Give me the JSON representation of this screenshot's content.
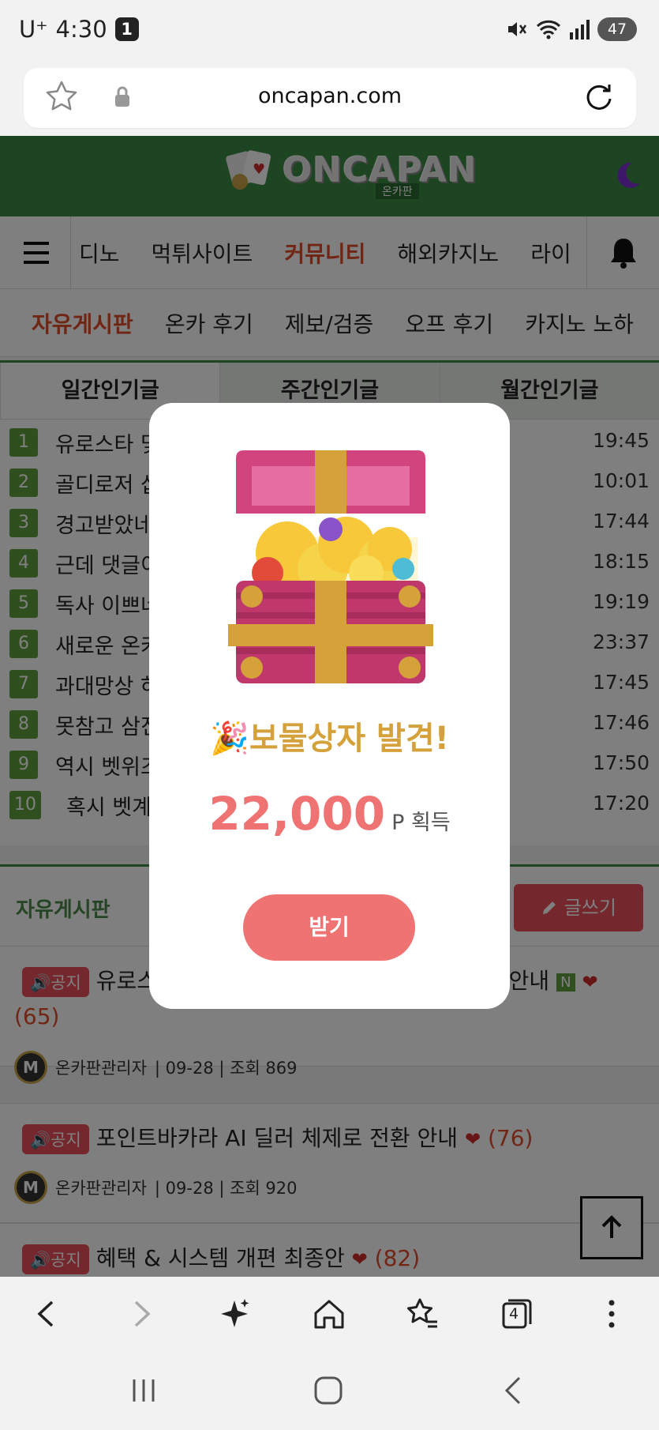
{
  "status_bar": {
    "carrier": "U⁺",
    "time": "4:30",
    "notif_count": "1",
    "battery": "47"
  },
  "browser": {
    "url": "oncapan.com",
    "tab_count": "4"
  },
  "site": {
    "logo_text": "ONCAPAN",
    "logo_sub": "온카판"
  },
  "nav": {
    "items": [
      {
        "label": "디노"
      },
      {
        "label": "먹튀사이트"
      },
      {
        "label": "커뮤니티"
      },
      {
        "label": "해외카지노"
      },
      {
        "label": "라이"
      }
    ]
  },
  "subnav": {
    "items": [
      {
        "label": "자유게시판"
      },
      {
        "label": "온카 후기"
      },
      {
        "label": "제보/검증"
      },
      {
        "label": "오프 후기"
      },
      {
        "label": "카지노 노하"
      }
    ]
  },
  "popular": {
    "tabs": [
      {
        "label": "일간인기글"
      },
      {
        "label": "주간인기글"
      },
      {
        "label": "월간인기글"
      }
    ],
    "rows": [
      {
        "num": "1",
        "title": "유로스타 몇",
        "time": "19:45"
      },
      {
        "num": "2",
        "title": "골디로저 삽",
        "time": "10:01"
      },
      {
        "num": "3",
        "title": "경고받았네",
        "time": "17:44"
      },
      {
        "num": "4",
        "title": "근데 댓글이",
        "time": "18:15"
      },
      {
        "num": "5",
        "title": "독사 이쁘네",
        "time": "19:19"
      },
      {
        "num": "6",
        "title": "새로운 온카",
        "time": "23:37"
      },
      {
        "num": "7",
        "title": "과대망상 하",
        "time": "17:45"
      },
      {
        "num": "8",
        "title": "못참고 삼진",
        "time": "17:46"
      },
      {
        "num": "9",
        "title": "역시 벳위즈",
        "time": "17:50"
      },
      {
        "num": "10",
        "title": "혹시 벳계",
        "time": "17:20"
      }
    ]
  },
  "board": {
    "title": "자유게시판",
    "write_label": "글쓰기",
    "notice_label": "공지",
    "posts": [
      {
        "title": "유로스",
        "title_tail": "편 안내",
        "new_badge": "N",
        "count": "(65)",
        "author": "온카판관리자",
        "meta": "| 09-28 | 조회 869",
        "avatar": "M"
      },
      {
        "title": "포인트바카라 AI 딜러 체제로 전환 안내",
        "count": "(76)",
        "author": "온카판관리자",
        "meta": "| 09-28 | 조회 920",
        "avatar": "M"
      },
      {
        "title": "혜택 & 시스템 개편 최종안",
        "count": "(82)"
      }
    ]
  },
  "modal": {
    "emoji": "🎉",
    "title": "보물상자 발견!",
    "amount": "22,000",
    "unit": "P 획득",
    "button": "받기"
  },
  "colors": {
    "brand_green": "#3a8a45",
    "accent_red": "#e04b2a",
    "modal_pink": "#ef7373",
    "gold": "#d4a13b"
  }
}
